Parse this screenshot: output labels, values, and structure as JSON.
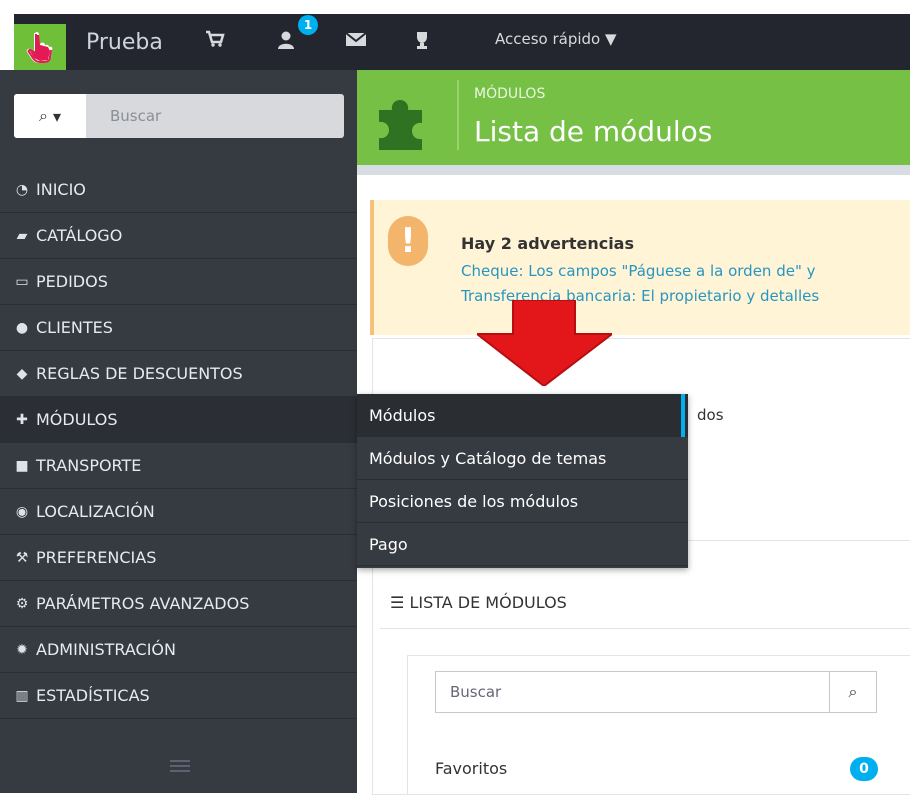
{
  "app": {
    "brand": "Prueba",
    "notification_count": "1",
    "quick_access_label": "Acceso rápido"
  },
  "top_icons": [
    "hand-cursor-icon",
    "cart-icon",
    "user-icon",
    "envelope-icon",
    "trophy-icon"
  ],
  "sidebar": {
    "search_placeholder": "Buscar",
    "items": [
      {
        "label": "INICIO",
        "icon": "dashboard-icon"
      },
      {
        "label": "CATÁLOGO",
        "icon": "book-icon"
      },
      {
        "label": "PEDIDOS",
        "icon": "credit-card-icon"
      },
      {
        "label": "CLIENTES",
        "icon": "users-icon"
      },
      {
        "label": "REGLAS DE DESCUENTOS",
        "icon": "tags-icon"
      },
      {
        "label": "MÓDULOS",
        "icon": "puzzle-icon"
      },
      {
        "label": "TRANSPORTE",
        "icon": "truck-icon"
      },
      {
        "label": "LOCALIZACIÓN",
        "icon": "globe-icon"
      },
      {
        "label": "PREFERENCIAS",
        "icon": "wrench-icon"
      },
      {
        "label": "PARÁMETROS AVANZADOS",
        "icon": "cogs-icon"
      },
      {
        "label": "ADMINISTRACIÓN",
        "icon": "gear-icon"
      },
      {
        "label": "ESTADÍSTICAS",
        "icon": "bar-chart-icon"
      }
    ]
  },
  "header": {
    "section": "MÓDULOS",
    "title": "Lista de módulos"
  },
  "alert": {
    "title": "Hay 2 advertencias",
    "line1": "Cheque: Los campos \"Páguese a la orden de\" y",
    "line2": "Transferencia bancaria: El propietario y detalles"
  },
  "panel_fragment": "dos",
  "submenu": {
    "items": [
      "Módulos",
      "Módulos y Catálogo de temas",
      "Posiciones de los módulos",
      "Pago"
    ]
  },
  "list_section": {
    "title": "LISTA DE MÓDULOS",
    "search_placeholder": "Buscar",
    "favorites_label": "Favoritos",
    "favorites_count": "0"
  },
  "colors": {
    "topbar": "#23262e",
    "sidebar": "#363a41",
    "accent_green": "#76c046",
    "badge_blue": "#00aff0",
    "alert_bg": "#fff4d6",
    "arrow_red": "#e3171a"
  }
}
